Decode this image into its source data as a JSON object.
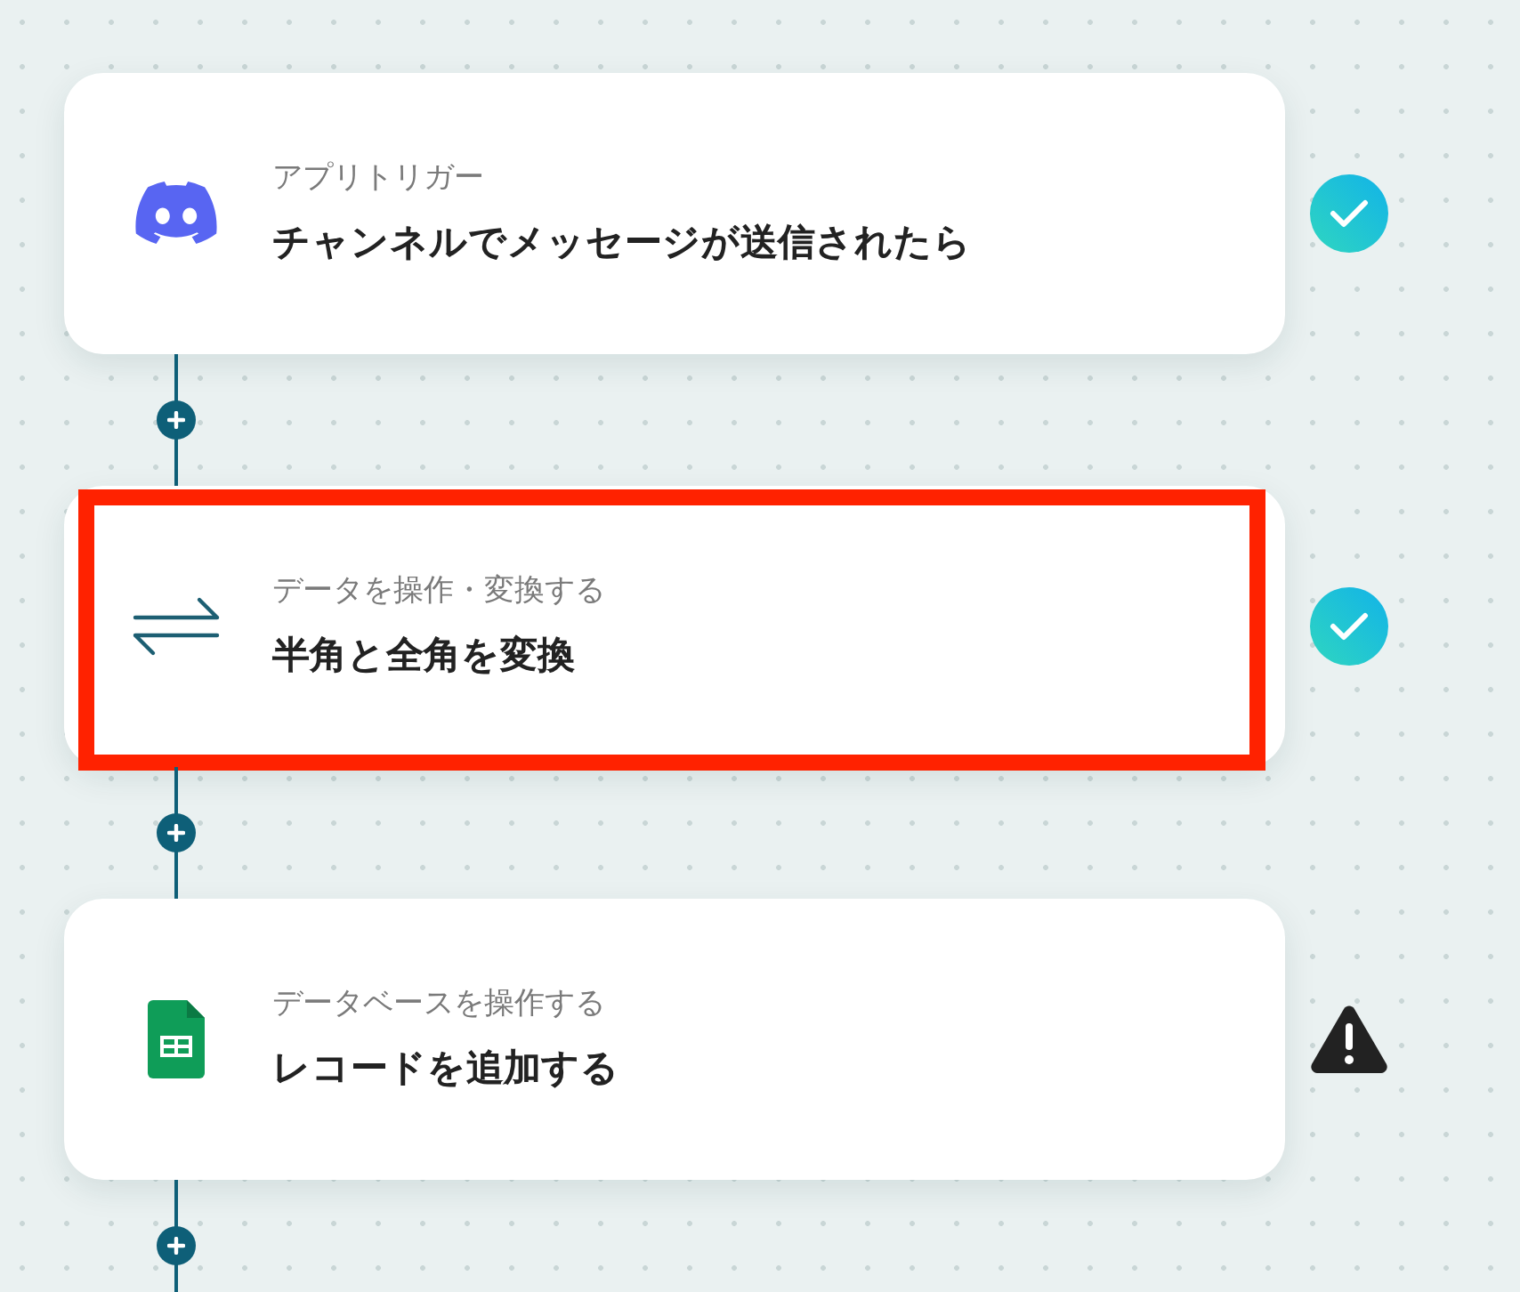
{
  "steps": [
    {
      "kind": "chat",
      "category": "アプリトリガー",
      "title": "チャンネルでメッセージが送信されたら",
      "completed": true,
      "highlighted": false
    },
    {
      "kind": "convert",
      "category": "データを操作・変換する",
      "title": "半角と全角を変換",
      "completed": true,
      "highlighted": true
    },
    {
      "kind": "sheet",
      "category": "データベースを操作する",
      "title": "レコードを追加する",
      "completed": false,
      "highlighted": false
    }
  ]
}
